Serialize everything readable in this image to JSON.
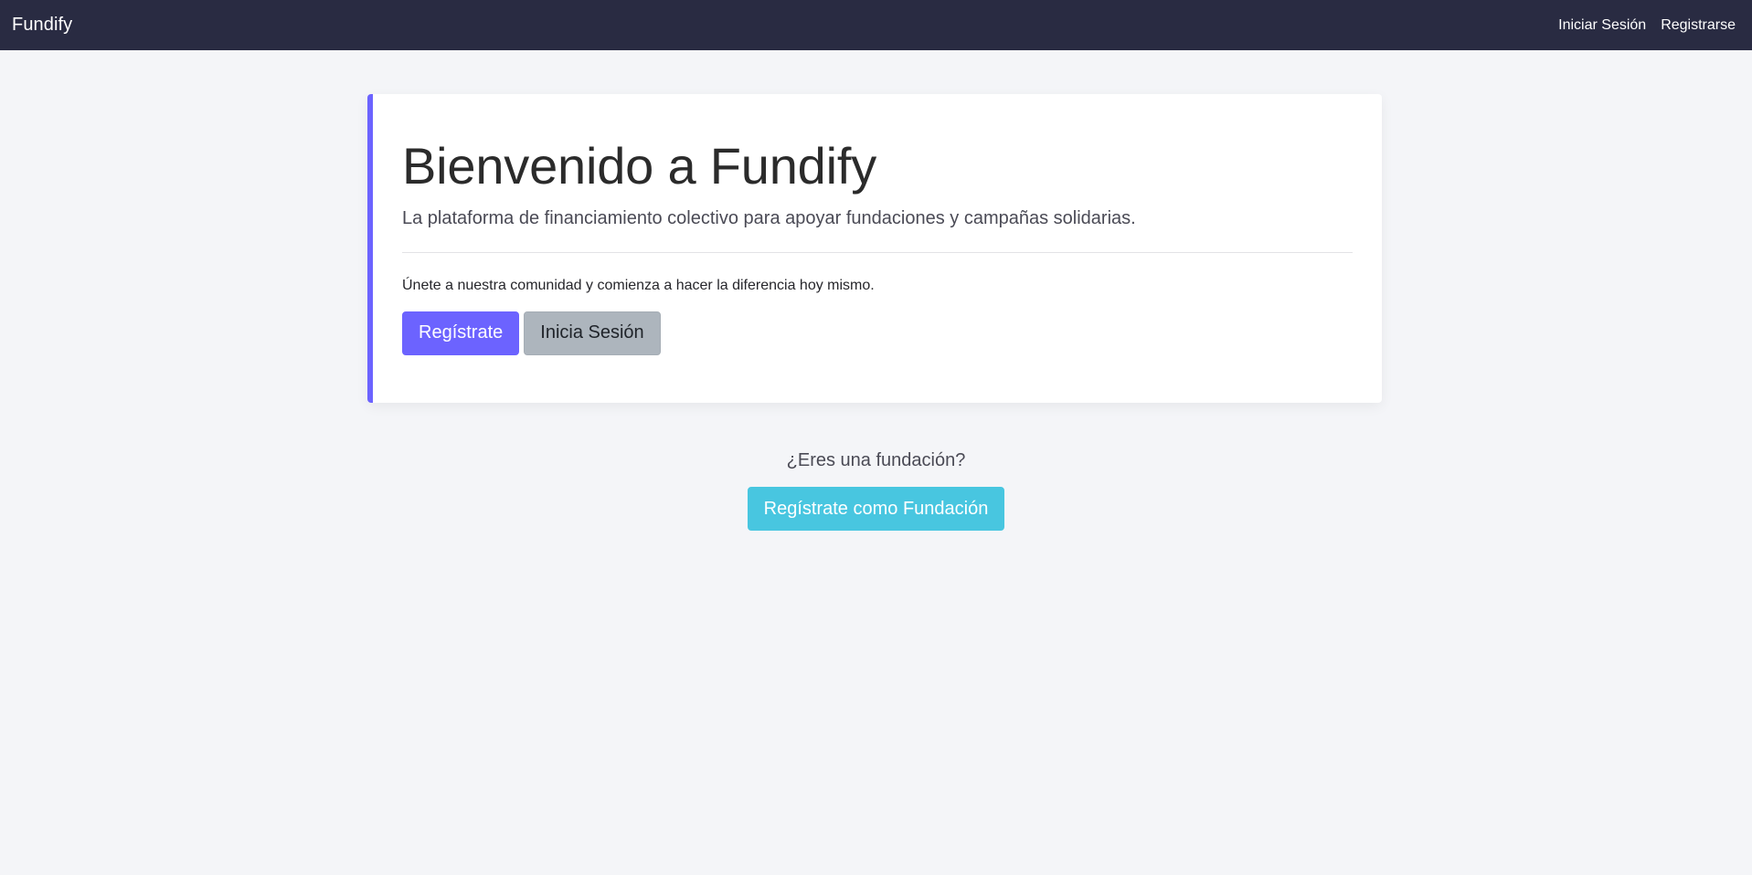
{
  "navbar": {
    "brand": "Fundify",
    "links": [
      {
        "label": "Iniciar Sesión"
      },
      {
        "label": "Registrarse"
      }
    ],
    "background": "#292b42"
  },
  "hero": {
    "title": "Bienvenido a Fundify",
    "lead": "La plataforma de financiamiento colectivo para apoyar fundaciones y campañas solidarias.",
    "text": "Únete a nuestra comunidad y comienza a hacer la diferencia hoy mismo.",
    "register_label": "Regístrate",
    "login_label": "Inicia Sesión",
    "accent": "#6c63ff"
  },
  "foundation": {
    "question": "¿Eres una fundación?",
    "register_label": "Regístrate como Fundación",
    "button_color": "#48c6e0"
  }
}
